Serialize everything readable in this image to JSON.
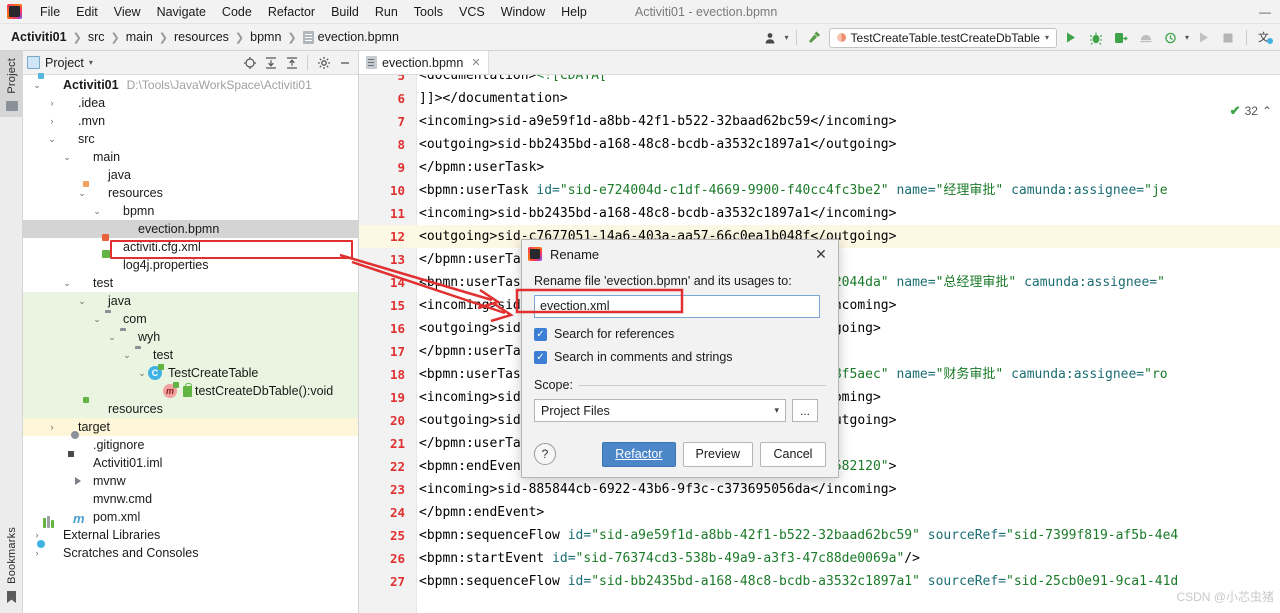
{
  "window": {
    "title": "Activiti01 - evection.bpmn",
    "minimize_label": "—",
    "maximize_label": "▢",
    "close_label": "✕"
  },
  "menu": {
    "items": [
      "File",
      "Edit",
      "View",
      "Navigate",
      "Code",
      "Refactor",
      "Build",
      "Run",
      "Tools",
      "VCS",
      "Window",
      "Help"
    ]
  },
  "breadcrumb": {
    "items": [
      "Activiti01",
      "src",
      "main",
      "resources",
      "bpmn",
      "evection.bpmn"
    ],
    "separator": "❯"
  },
  "toolbar": {
    "user_icon": "user-icon",
    "user_caret": "▾",
    "build_icon": "hammer-icon",
    "run_config": "TestCreateTable.testCreateDbTable",
    "run_config_caret": "▾",
    "run_label": "▶",
    "debug_label": "debug-icon",
    "run_coverage_label": "run-with-coverage-icon",
    "profile_label": "profiler-icon",
    "stop_label": "■",
    "rerun_label": "▶",
    "search_everywhere": "translate-icon"
  },
  "left_strip": {
    "project_tab": "Project",
    "bookmarks_tab": "Bookmarks"
  },
  "project_panel": {
    "title": "Project",
    "title_caret": "▾",
    "header_icons": [
      "locate-icon",
      "expand-all-icon",
      "collapse-all-icon",
      "gear-icon",
      "hide-icon"
    ],
    "tree": [
      {
        "indent": 0,
        "arrow": "⌄",
        "icon": "folder-module",
        "label": "Activiti01",
        "bold": true,
        "hint": "D:\\Tools\\JavaWorkSpace\\Activiti01",
        "bg": "none"
      },
      {
        "indent": 1,
        "arrow": "›",
        "icon": "folder-grey",
        "label": ".idea",
        "bold": false,
        "hint": "",
        "bg": "none"
      },
      {
        "indent": 1,
        "arrow": "›",
        "icon": "folder-grey",
        "label": ".mvn",
        "bold": false,
        "hint": "",
        "bg": "none"
      },
      {
        "indent": 1,
        "arrow": "⌄",
        "icon": "folder-grey",
        "label": "src",
        "bold": false,
        "hint": "",
        "bg": "none"
      },
      {
        "indent": 2,
        "arrow": "⌄",
        "icon": "folder-grey",
        "label": "main",
        "bold": false,
        "hint": "",
        "bg": "none"
      },
      {
        "indent": 3,
        "arrow": "",
        "icon": "folder-blue",
        "label": "java",
        "bold": false,
        "hint": "",
        "bg": "none"
      },
      {
        "indent": 3,
        "arrow": "⌄",
        "icon": "folder-resources",
        "label": "resources",
        "bold": false,
        "hint": "",
        "bg": "none"
      },
      {
        "indent": 4,
        "arrow": "⌄",
        "icon": "folder-grey",
        "label": "bpmn",
        "bold": false,
        "hint": "",
        "bg": "none"
      },
      {
        "indent": 5,
        "arrow": "",
        "icon": "file-bpmn",
        "label": "evection.bpmn",
        "bold": false,
        "hint": "",
        "bg": "selected"
      },
      {
        "indent": 4,
        "arrow": "",
        "icon": "file-xml",
        "label": "activiti.cfg.xml",
        "bold": false,
        "hint": "",
        "bg": "none"
      },
      {
        "indent": 4,
        "arrow": "",
        "icon": "file-properties",
        "label": "log4j.properties",
        "bold": false,
        "hint": "",
        "bg": "none"
      },
      {
        "indent": 2,
        "arrow": "⌄",
        "icon": "folder-grey",
        "label": "test",
        "bold": false,
        "hint": "",
        "bg": "none"
      },
      {
        "indent": 3,
        "arrow": "⌄",
        "icon": "folder-green",
        "label": "java",
        "bold": false,
        "hint": "",
        "bg": "green"
      },
      {
        "indent": 4,
        "arrow": "⌄",
        "icon": "package",
        "label": "com",
        "bold": false,
        "hint": "",
        "bg": "green"
      },
      {
        "indent": 5,
        "arrow": "⌄",
        "icon": "package",
        "label": "wyh",
        "bold": false,
        "hint": "",
        "bg": "green"
      },
      {
        "indent": 6,
        "arrow": "⌄",
        "icon": "package",
        "label": "test",
        "bold": false,
        "hint": "",
        "bg": "green"
      },
      {
        "indent": 7,
        "arrow": "⌄",
        "icon": "class",
        "label": "TestCreateTable",
        "bold": false,
        "hint": "",
        "bg": "green"
      },
      {
        "indent": 8,
        "arrow": "",
        "icon": "method",
        "label": "testCreateDbTable():void",
        "bold": false,
        "hint": "",
        "bg": "green"
      },
      {
        "indent": 3,
        "arrow": "",
        "icon": "folder-test-resources",
        "label": "resources",
        "bold": false,
        "hint": "",
        "bg": "green"
      },
      {
        "indent": 1,
        "arrow": "›",
        "icon": "folder-orange",
        "label": "target",
        "bold": false,
        "hint": "",
        "bg": "yellow"
      },
      {
        "indent": 2,
        "arrow": "",
        "icon": "file-git",
        "label": ".gitignore",
        "bold": false,
        "hint": "",
        "bg": "none"
      },
      {
        "indent": 2,
        "arrow": "",
        "icon": "file-iml",
        "label": "Activiti01.iml",
        "bold": false,
        "hint": "",
        "bg": "none"
      },
      {
        "indent": 2,
        "arrow": "",
        "icon": "file-run",
        "label": "mvnw",
        "bold": false,
        "hint": "",
        "bg": "none"
      },
      {
        "indent": 2,
        "arrow": "",
        "icon": "file-cmd",
        "label": "mvnw.cmd",
        "bold": false,
        "hint": "",
        "bg": "none"
      },
      {
        "indent": 2,
        "arrow": "",
        "icon": "file-maven",
        "label": "pom.xml",
        "bold": false,
        "hint": "",
        "bg": "none"
      },
      {
        "indent": 0,
        "arrow": "›",
        "icon": "libraries",
        "label": "External Libraries",
        "bold": false,
        "hint": "",
        "bg": "none"
      },
      {
        "indent": 0,
        "arrow": "›",
        "icon": "scratches",
        "label": "Scratches and Consoles",
        "bold": false,
        "hint": "",
        "bg": "none"
      }
    ]
  },
  "editor": {
    "tab_label": "evection.bpmn",
    "tab_close": "✕",
    "inspection_count": "32",
    "inspection_check": "✔",
    "inspection_caret": "⌃",
    "watermark": "CSDN @小芯虫猪",
    "lines": [
      {
        "num": "5",
        "highlight": false,
        "clipped_top": true,
        "segments": [
          {
            "t": "                ",
            "c": "txt"
          },
          {
            "t": "<documentation>",
            "c": "tag"
          },
          {
            "t": "<![CDATA[",
            "c": "cdata"
          }
        ]
      },
      {
        "num": "6",
        "highlight": false,
        "segments": [
          {
            "t": "    ]]>",
            "c": "txt"
          },
          {
            "t": "</documentation>",
            "c": "tag"
          }
        ]
      },
      {
        "num": "7",
        "highlight": false,
        "segments": [
          {
            "t": "        ",
            "c": "txt"
          },
          {
            "t": "<incoming>",
            "c": "tag"
          },
          {
            "t": "sid-a9e59f1d-a8bb-42f1-b522-32baad62bc59",
            "c": "txt"
          },
          {
            "t": "</incoming>",
            "c": "tag"
          }
        ]
      },
      {
        "num": "8",
        "highlight": false,
        "segments": [
          {
            "t": "        ",
            "c": "txt"
          },
          {
            "t": "<outgoing>",
            "c": "tag"
          },
          {
            "t": "sid-bb2435bd-a168-48c8-bcdb-a3532c1897a1",
            "c": "txt"
          },
          {
            "t": "</outgoing>",
            "c": "tag"
          }
        ]
      },
      {
        "num": "9",
        "highlight": false,
        "segments": [
          {
            "t": "    ",
            "c": "txt"
          },
          {
            "t": "</bpmn:userTask>",
            "c": "tag"
          }
        ]
      },
      {
        "num": "10",
        "highlight": false,
        "segments": [
          {
            "t": "    ",
            "c": "txt"
          },
          {
            "t": "<bpmn:userTask ",
            "c": "tag"
          },
          {
            "t": "id=",
            "c": "attr"
          },
          {
            "t": "\"sid-e724004d-c1df-4669-9900-f40cc4fc3be2\"",
            "c": "val"
          },
          {
            "t": " name=",
            "c": "attr"
          },
          {
            "t": "\"经理审批\"",
            "c": "val"
          },
          {
            "t": " camunda:assignee=",
            "c": "attr"
          },
          {
            "t": "\"je",
            "c": "val"
          }
        ]
      },
      {
        "num": "11",
        "highlight": false,
        "segments": [
          {
            "t": "        ",
            "c": "txt"
          },
          {
            "t": "<incoming>",
            "c": "tag"
          },
          {
            "t": "sid-bb2435bd-a168-48c8-bcdb-a3532c1897a1",
            "c": "txt"
          },
          {
            "t": "</incoming>",
            "c": "tag"
          }
        ]
      },
      {
        "num": "12",
        "highlight": true,
        "segments": [
          {
            "t": "        ",
            "c": "txt"
          },
          {
            "t": "<outgoing>",
            "c": "tag"
          },
          {
            "t": "sid-c7677051-14a6-403a-aa57-66c0ea1b048f",
            "c": "txt"
          },
          {
            "t": "</outgoing>",
            "c": "tag"
          }
        ]
      },
      {
        "num": "13",
        "highlight": false,
        "segments": [
          {
            "t": "    ",
            "c": "txt"
          },
          {
            "t": "</bpmn:userTask>",
            "c": "tag"
          }
        ]
      },
      {
        "num": "14",
        "highlight": false,
        "segments": [
          {
            "t": "    ",
            "c": "txt"
          },
          {
            "t": "<bpmn:userTask ",
            "c": "tag"
          },
          {
            "t": "id=",
            "c": "attr"
          },
          {
            "t": "\"sid-XXXXXXXX-XXXX-4XXX-XXf2-1ad3652044da\"",
            "c": "val"
          },
          {
            "t": " name=",
            "c": "attr"
          },
          {
            "t": "\"总经理审批\"",
            "c": "val"
          },
          {
            "t": " camunda:assignee=",
            "c": "attr"
          },
          {
            "t": "\"",
            "c": "val"
          }
        ]
      },
      {
        "num": "15",
        "highlight": false,
        "segments": [
          {
            "t": "        ",
            "c": "txt"
          },
          {
            "t": "<incoming>",
            "c": "tag"
          },
          {
            "t": "sid-c7677051-14a6-403a-aa57-66c0ea1b048f",
            "c": "txt"
          },
          {
            "t": "</incoming>",
            "c": "tag"
          }
        ]
      },
      {
        "num": "16",
        "highlight": false,
        "segments": [
          {
            "t": "        ",
            "c": "txt"
          },
          {
            "t": "<outgoing>",
            "c": "tag"
          },
          {
            "t": "sid-XXXXXXXX-XXXX-XXXX-XXXX-XX7ccca4ef",
            "c": "txt"
          },
          {
            "t": "</outgoing>",
            "c": "tag"
          }
        ]
      },
      {
        "num": "17",
        "highlight": false,
        "segments": [
          {
            "t": "    ",
            "c": "txt"
          },
          {
            "t": "</bpmn:userTask>",
            "c": "tag"
          }
        ]
      },
      {
        "num": "18",
        "highlight": false,
        "segments": [
          {
            "t": "    ",
            "c": "txt"
          },
          {
            "t": "<bpmn:userTask ",
            "c": "tag"
          },
          {
            "t": "id=",
            "c": "attr"
          },
          {
            "t": "\"sid-XXXXXXXX-XXXX-XXXX-XXac-728e548f5aec\"",
            "c": "val"
          },
          {
            "t": " name=",
            "c": "attr"
          },
          {
            "t": "\"财务审批\"",
            "c": "val"
          },
          {
            "t": " camunda:assignee=",
            "c": "attr"
          },
          {
            "t": "\"ro",
            "c": "val"
          }
        ]
      },
      {
        "num": "19",
        "highlight": false,
        "segments": [
          {
            "t": "        ",
            "c": "txt"
          },
          {
            "t": "<incoming>",
            "c": "tag"
          },
          {
            "t": "sid-XXXXXXXX-XXXX-XXXX-XXXX-XX7ccca4ef",
            "c": "txt"
          },
          {
            "t": "</incoming>",
            "c": "tag"
          }
        ]
      },
      {
        "num": "20",
        "highlight": false,
        "segments": [
          {
            "t": "        ",
            "c": "txt"
          },
          {
            "t": "<outgoing>",
            "c": "tag"
          },
          {
            "t": "sid-885844cb-6922-43b6-9f3c-c373695056da",
            "c": "txt"
          },
          {
            "t": "</outgoing>",
            "c": "tag"
          }
        ]
      },
      {
        "num": "21",
        "highlight": false,
        "segments": [
          {
            "t": "    ",
            "c": "txt"
          },
          {
            "t": "</bpmn:userTask>",
            "c": "tag"
          }
        ]
      },
      {
        "num": "22",
        "highlight": false,
        "segments": [
          {
            "t": "    ",
            "c": "txt"
          },
          {
            "t": "<bpmn:endEvent ",
            "c": "tag"
          },
          {
            "t": "id=",
            "c": "attr"
          },
          {
            "t": "\"sid-112a2066-07de-416c-99e7-019e3d582120\"",
            "c": "val"
          },
          {
            "t": ">",
            "c": "tag"
          }
        ]
      },
      {
        "num": "23",
        "highlight": false,
        "segments": [
          {
            "t": "        ",
            "c": "txt"
          },
          {
            "t": "<incoming>",
            "c": "tag"
          },
          {
            "t": "sid-885844cb-6922-43b6-9f3c-c373695056da",
            "c": "txt"
          },
          {
            "t": "</incoming>",
            "c": "tag"
          }
        ]
      },
      {
        "num": "24",
        "highlight": false,
        "segments": [
          {
            "t": "    ",
            "c": "txt"
          },
          {
            "t": "</bpmn:endEvent>",
            "c": "tag"
          }
        ]
      },
      {
        "num": "25",
        "highlight": false,
        "segments": [
          {
            "t": "    ",
            "c": "txt"
          },
          {
            "t": "<bpmn:sequenceFlow ",
            "c": "tag"
          },
          {
            "t": "id=",
            "c": "attr"
          },
          {
            "t": "\"sid-a9e59f1d-a8bb-42f1-b522-32baad62bc59\"",
            "c": "val"
          },
          {
            "t": " sourceRef=",
            "c": "attr"
          },
          {
            "t": "\"sid-7399f819-af5b-4e4",
            "c": "val"
          }
        ]
      },
      {
        "num": "26",
        "highlight": false,
        "segments": [
          {
            "t": "    ",
            "c": "txt"
          },
          {
            "t": "<bpmn:startEvent ",
            "c": "tag"
          },
          {
            "t": "id=",
            "c": "attr"
          },
          {
            "t": "\"sid-76374cd3-538b-49a9-a3f3-47c88de0069a\"",
            "c": "val"
          },
          {
            "t": "/>",
            "c": "tag"
          }
        ]
      },
      {
        "num": "27",
        "highlight": false,
        "segments": [
          {
            "t": "    ",
            "c": "txt"
          },
          {
            "t": "<bpmn:sequenceFlow ",
            "c": "tag"
          },
          {
            "t": "id=",
            "c": "attr"
          },
          {
            "t": "\"sid-bb2435bd-a168-48c8-bcdb-a3532c1897a1\"",
            "c": "val"
          },
          {
            "t": " sourceRef=",
            "c": "attr"
          },
          {
            "t": "\"sid-25cb0e91-9ca1-41d",
            "c": "val"
          }
        ]
      }
    ]
  },
  "dialog": {
    "title": "Rename",
    "close_label": "✕",
    "prompt": "Rename file 'evection.bpmn' and its usages to:",
    "input_value": "evection.xml",
    "checkbox_references": "Search for references",
    "checkbox_comments": "Search in comments and strings",
    "checkbox_mark": "✓",
    "scope_label": "Scope:",
    "scope_value": "Project Files",
    "scope_caret": "▾",
    "ellipsis_label": "...",
    "help_label": "?",
    "refactor_label": "Refactor",
    "preview_label": "Preview",
    "cancel_label": "Cancel"
  },
  "colors": {
    "accent_blue": "#4a86c8",
    "annotation_red": "#e03030",
    "green": "#3fa34a",
    "line_number_red": "#e03030"
  }
}
